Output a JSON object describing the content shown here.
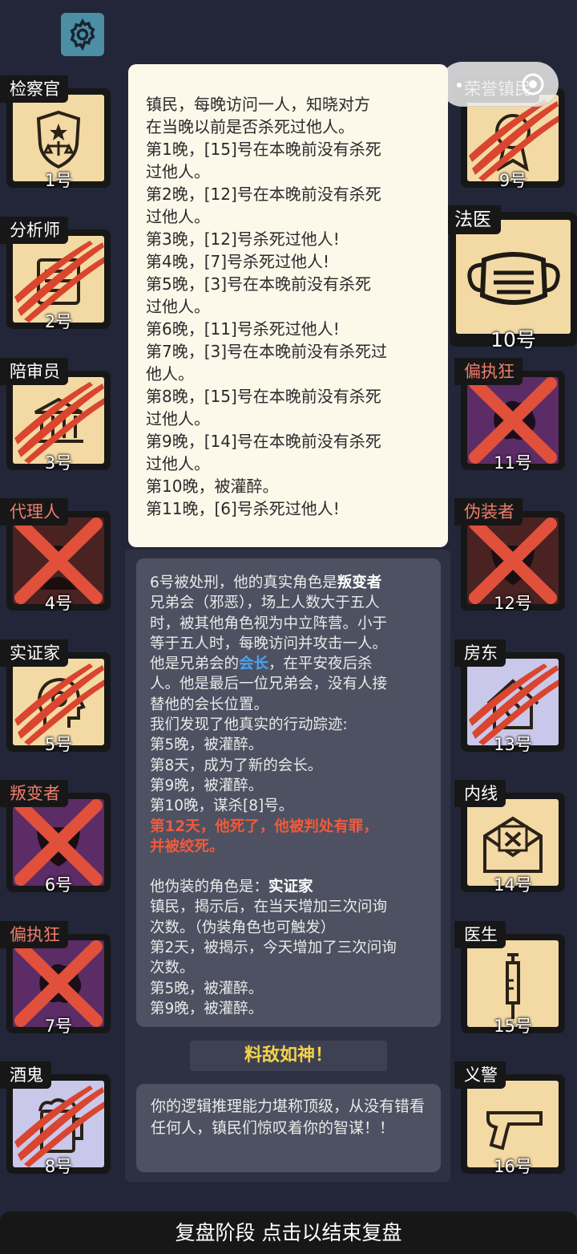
{
  "settings": {
    "icon": "gear-icon"
  },
  "left_cards": [
    {
      "role": "检察官",
      "number": "1号",
      "icon": "prosecutor-badge-icon",
      "bg": "#f3d9a4",
      "mark": "none"
    },
    {
      "role": "分析师",
      "number": "2号",
      "icon": "analyst-icon",
      "bg": "#f3d9a4",
      "mark": "claw"
    },
    {
      "role": "陪审员",
      "number": "3号",
      "icon": "courthouse-icon",
      "bg": "#f3d9a4",
      "mark": "claw"
    },
    {
      "role": "代理人",
      "number": "4号",
      "icon": "spy-icon",
      "bg": "#4a2222",
      "mark": "x"
    },
    {
      "role": "实证家",
      "number": "5号",
      "icon": "head-icon",
      "bg": "#f3d9a4",
      "mark": "claw"
    },
    {
      "role": "叛变者",
      "number": "6号",
      "icon": "mask-icon",
      "bg": "#5c2c66",
      "mark": "x"
    },
    {
      "role": "偏执狂",
      "number": "7号",
      "icon": "brain-icon",
      "bg": "#5c2c66",
      "mark": "x"
    },
    {
      "role": "酒鬼",
      "number": "8号",
      "icon": "beer-icon",
      "bg": "#c9c7ea",
      "mark": "claw"
    }
  ],
  "right_cards": [
    {
      "role": "荣誉镇民",
      "number": "9号",
      "icon": "medal-icon",
      "bg": "#f3d9a4",
      "mark": "claw"
    },
    {
      "role": "法医",
      "number": "10号",
      "icon": "face-mask-icon",
      "bg": "#f3d9a4",
      "mark": "none"
    },
    {
      "role": "偏执狂",
      "number": "11号",
      "icon": "brain-icon",
      "bg": "#5c2c66",
      "mark": "x"
    },
    {
      "role": "伪装者",
      "number": "12号",
      "icon": "mask-icon",
      "bg": "#4a2222",
      "mark": "x"
    },
    {
      "role": "房东",
      "number": "13号",
      "icon": "house-icon",
      "bg": "#c9c7ea",
      "mark": "claw"
    },
    {
      "role": "内线",
      "number": "14号",
      "icon": "envelope-x-icon",
      "bg": "#f3d9a4",
      "mark": "none"
    },
    {
      "role": "医生",
      "number": "15号",
      "icon": "syringe-icon",
      "bg": "#f3d9a4",
      "mark": "none"
    },
    {
      "role": "义警",
      "number": "16号",
      "icon": "pistol-icon",
      "bg": "#f3d9a4",
      "mark": "none"
    }
  ],
  "role_description": [
    "镇民，每晚访问一人，知晓对方",
    "在当晚以前是否杀死过他人。",
    "第1晚，[15]号在本晚前没有杀死",
    "过他人。",
    "第2晚，[12]号在本晚前没有杀死",
    "过他人。",
    "第3晚，[12]号杀死过他人!",
    "第4晚，[7]号杀死过他人!",
    "第5晚，[3]号在本晚前没有杀死",
    "过他人。",
    "第6晚，[11]号杀死过他人!",
    "第7晚，[3]号在本晚前没有杀死过",
    "他人。",
    "第8晚，[15]号在本晚前没有杀死",
    "过他人。",
    "第9晚，[14]号在本晚前没有杀死",
    "过他人。",
    "第10晚，被灌醉。",
    "第11晚，[6]号杀死过他人!"
  ],
  "execution": {
    "intro": "6号被处刑，他的真实角色是",
    "true_role": "叛变者",
    "desc_lines": [
      "兄弟会（邪恶），场上人数大于五人",
      "时，被其他角色视为中立阵营。小于",
      "等于五人时，每晚访问并攻击一人。"
    ],
    "leader_pre": "他是兄弟会的",
    "leader_word": "会长",
    "leader_post": "，在平安夜后杀",
    "desc_lines2": [
      "人。他是最后一位兄弟会，没有人接",
      "替他的会长位置。",
      "我们发现了他真实的行动踪迹:",
      "第5晚，被灌醉。",
      "第8天，成为了新的会长。",
      "第9晚，被灌醉。",
      "第10晚，谋杀[8]号。"
    ],
    "death_lines": [
      "第12天，他死了，他被判处有罪，",
      "并被绞死。"
    ],
    "disguise_label": "他伪装的角色是：",
    "disguise_role": "实证家",
    "disguise_lines": [
      "镇民，揭示后，在当天增加三次问询",
      "次数。（伪装角色也可触发）",
      "第2天，被揭示，今天增加了三次问询",
      "次数。",
      "第5晚，被灌醉。",
      "第9晚，被灌醉。"
    ]
  },
  "verdict": "料敌如神！",
  "comment": "你的逻辑推理能力堪称顶级，从没有错看任何人，镇民们惊叹着你的智谋！！",
  "bottom_bar": "复盘阶段 点击以结束复盘",
  "colors": {
    "cream": "#f3d9a4",
    "claw_red": "#d9452e",
    "x_red": "#e0503a",
    "highlight_blue": "#4ba3f0",
    "death_red": "#f05a3c",
    "verdict_yellow": "#f5d24a"
  }
}
